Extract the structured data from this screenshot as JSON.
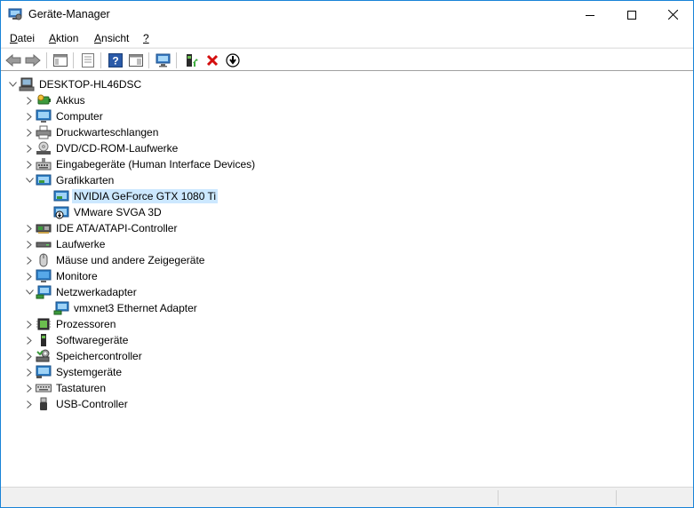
{
  "window": {
    "title": "Geräte-Manager"
  },
  "menu": {
    "items": [
      {
        "key": "D",
        "rest": "atei"
      },
      {
        "key": "A",
        "rest": "ktion"
      },
      {
        "key": "A",
        "rest": "nsicht"
      },
      {
        "key": "?",
        "rest": ""
      }
    ]
  },
  "toolbar": {
    "buttons": [
      "back-icon",
      "forward-icon",
      "show-hide-console-tree-icon",
      "properties-icon",
      "help-icon",
      "action-pane-icon",
      "scan-hardware-icon",
      "update-driver-icon",
      "uninstall-icon",
      "disable-device-icon"
    ]
  },
  "tree": {
    "root": "DESKTOP-HL46DSC",
    "items": [
      {
        "label": "Akkus",
        "expanded": false,
        "icon": "battery-icon"
      },
      {
        "label": "Computer",
        "expanded": false,
        "icon": "computer-icon"
      },
      {
        "label": "Druckwarteschlangen",
        "expanded": false,
        "icon": "printer-icon"
      },
      {
        "label": "DVD/CD-ROM-Laufwerke",
        "expanded": false,
        "icon": "dvd-icon"
      },
      {
        "label": "Eingabegeräte (Human Interface Devices)",
        "expanded": false,
        "icon": "hid-icon"
      },
      {
        "label": "Grafikkarten",
        "expanded": true,
        "icon": "display-adapter-icon",
        "children": [
          {
            "label": "NVIDIA GeForce GTX 1080 Ti",
            "selected": true,
            "icon": "display-adapter-icon"
          },
          {
            "label": "VMware SVGA 3D",
            "selected": false,
            "icon": "display-adapter-disabled-icon"
          }
        ]
      },
      {
        "label": "IDE ATA/ATAPI-Controller",
        "expanded": false,
        "icon": "ide-controller-icon"
      },
      {
        "label": "Laufwerke",
        "expanded": false,
        "icon": "disk-drive-icon"
      },
      {
        "label": "Mäuse und andere Zeigegeräte",
        "expanded": false,
        "icon": "mouse-icon"
      },
      {
        "label": "Monitore",
        "expanded": false,
        "icon": "monitor-icon"
      },
      {
        "label": "Netzwerkadapter",
        "expanded": true,
        "icon": "network-adapter-icon",
        "children": [
          {
            "label": "vmxnet3 Ethernet Adapter",
            "selected": false,
            "icon": "network-adapter-icon"
          }
        ]
      },
      {
        "label": "Prozessoren",
        "expanded": false,
        "icon": "processor-icon"
      },
      {
        "label": "Softwaregeräte",
        "expanded": false,
        "icon": "software-device-icon"
      },
      {
        "label": "Speichercontroller",
        "expanded": false,
        "icon": "storage-controller-icon"
      },
      {
        "label": "Systemgeräte",
        "expanded": false,
        "icon": "system-device-icon"
      },
      {
        "label": "Tastaturen",
        "expanded": false,
        "icon": "keyboard-icon"
      },
      {
        "label": "USB-Controller",
        "expanded": false,
        "icon": "usb-icon"
      }
    ]
  },
  "colors": {
    "selection": "#cce8ff",
    "window_border": "#1883d7"
  }
}
